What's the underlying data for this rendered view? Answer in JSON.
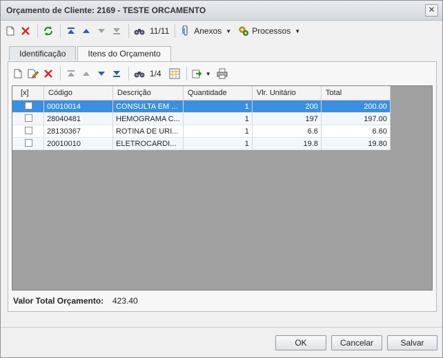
{
  "window": {
    "title": "Orçamento de Cliente: 2169 - TESTE ORCAMENTO",
    "close_glyph": "✕"
  },
  "main_toolbar": {
    "record_counter": "11/11",
    "anexos_label": "Anexos",
    "processos_label": "Processos"
  },
  "tabs": [
    {
      "label": "Identificação"
    },
    {
      "label": "Itens do Orçamento"
    }
  ],
  "items_toolbar": {
    "record_counter": "1/4"
  },
  "grid": {
    "columns": [
      "[x]",
      "Código",
      "Descrição",
      "Quantidade",
      "Vlr. Unitário",
      "Total"
    ],
    "rows": [
      {
        "codigo": "00010014",
        "descricao": "CONSULTA EM ...",
        "quantidade": "1",
        "unitario": "200",
        "total": "200.00"
      },
      {
        "codigo": "28040481",
        "descricao": "HEMOGRAMA C...",
        "quantidade": "1",
        "unitario": "197",
        "total": "197.00"
      },
      {
        "codigo": "28130367",
        "descricao": "ROTINA DE URI...",
        "quantidade": "1",
        "unitario": "6.6",
        "total": "6.60"
      },
      {
        "codigo": "20010010",
        "descricao": "ELETROCARDI...",
        "quantidade": "1",
        "unitario": "19.8",
        "total": "19.80"
      }
    ]
  },
  "summary": {
    "label": "Valor Total Orçamento:",
    "value": "423.40"
  },
  "buttons": {
    "ok": "OK",
    "cancelar": "Cancelar",
    "salvar": "Salvar"
  }
}
